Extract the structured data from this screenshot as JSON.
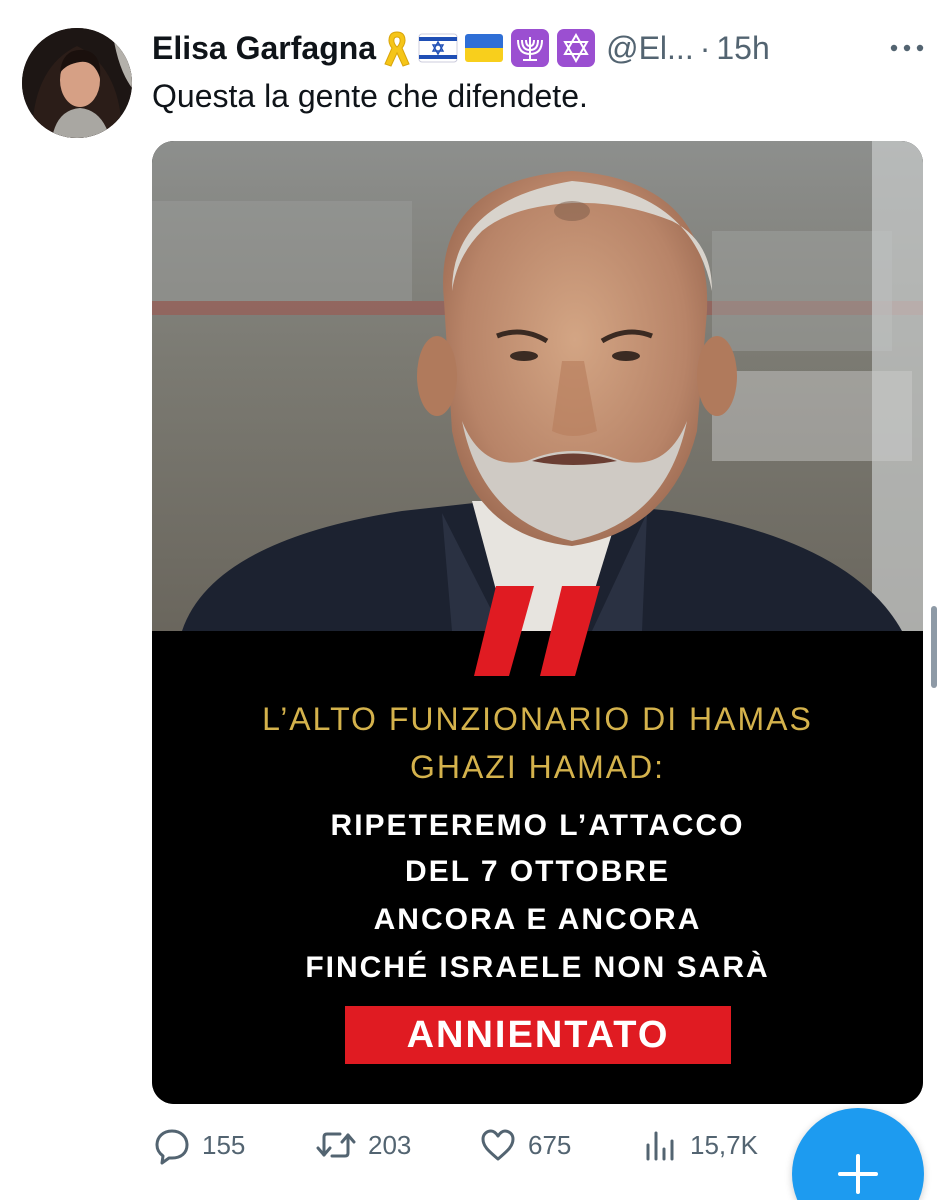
{
  "tweet": {
    "author_name": "Elisa Garfagna",
    "handle": "@El...",
    "separator": "·",
    "time": "15h",
    "text": "Questa la gente che difendete.",
    "emoji_icons": [
      "yellow-ribbon",
      "israel-flag",
      "ukraine-flag",
      "menorah",
      "star-of-david"
    ]
  },
  "media": {
    "quote_mark": "”",
    "caption_gold_line1": "L’ALTO FUNZIONARIO DI HAMAS",
    "caption_gold_line2": "GHAZI HAMAD:",
    "caption_white_lines": [
      "RIPETEREMO L’ATTACCO",
      "DEL 7 OTTOBRE",
      "ANCORA E ANCORA",
      "FINCHÉ ISRAELE NON SARÀ"
    ],
    "highlight": "ANNIENTATO"
  },
  "actions": {
    "replies": "155",
    "reposts": "203",
    "likes": "675",
    "views": "15,7K"
  },
  "colors": {
    "accent": "#1d9bf0",
    "secondary_text": "#536471",
    "gold": "#d4b24c",
    "red": "#e01b22"
  }
}
